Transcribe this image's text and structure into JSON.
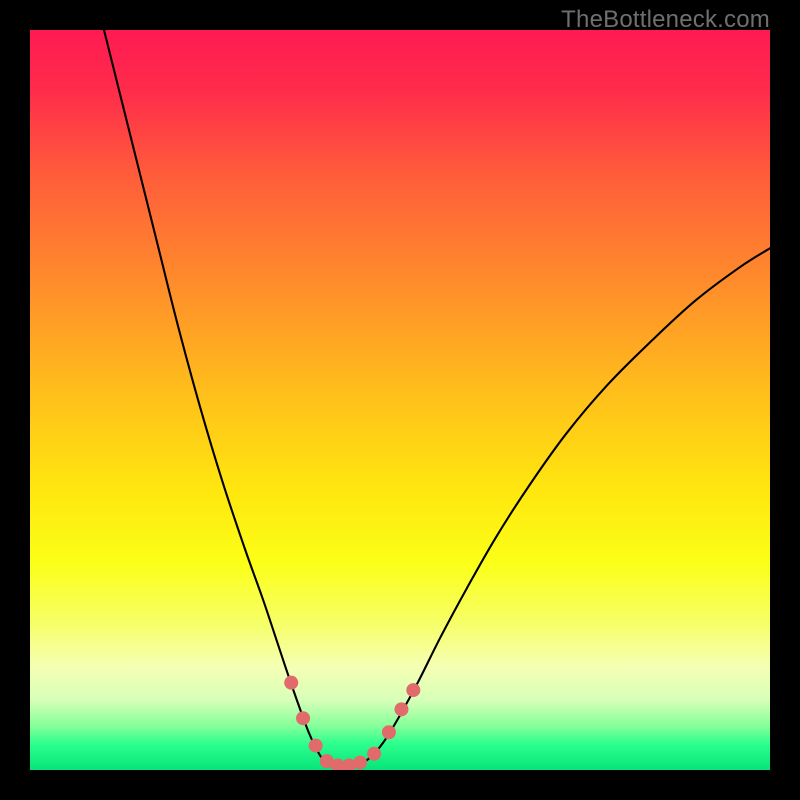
{
  "watermark": "TheBottleneck.com",
  "chart_data": {
    "type": "line",
    "title": "",
    "xlabel": "",
    "ylabel": "",
    "xlim": [
      0,
      100
    ],
    "ylim": [
      0,
      100
    ],
    "background_gradient": {
      "stops": [
        {
          "offset": 0.0,
          "color": "#ff1a52"
        },
        {
          "offset": 0.08,
          "color": "#ff2b4b"
        },
        {
          "offset": 0.2,
          "color": "#ff5e3a"
        },
        {
          "offset": 0.35,
          "color": "#ff8f2a"
        },
        {
          "offset": 0.5,
          "color": "#ffc21a"
        },
        {
          "offset": 0.62,
          "color": "#ffe60f"
        },
        {
          "offset": 0.72,
          "color": "#fbff17"
        },
        {
          "offset": 0.8,
          "color": "#f6ff66"
        },
        {
          "offset": 0.86,
          "color": "#f5ffb3"
        },
        {
          "offset": 0.905,
          "color": "#d8ffb8"
        },
        {
          "offset": 0.94,
          "color": "#86ff9a"
        },
        {
          "offset": 0.965,
          "color": "#2bff8d"
        },
        {
          "offset": 1.0,
          "color": "#08e47a"
        }
      ]
    },
    "series": [
      {
        "name": "curve-left",
        "color": "#000000",
        "width": 2.1,
        "points": [
          {
            "x": 10.0,
            "y": 100.0
          },
          {
            "x": 12.0,
            "y": 92.0
          },
          {
            "x": 14.5,
            "y": 82.0
          },
          {
            "x": 17.0,
            "y": 72.0
          },
          {
            "x": 20.0,
            "y": 60.0
          },
          {
            "x": 23.0,
            "y": 49.0
          },
          {
            "x": 26.0,
            "y": 39.0
          },
          {
            "x": 29.0,
            "y": 30.0
          },
          {
            "x": 31.5,
            "y": 23.0
          },
          {
            "x": 33.5,
            "y": 17.0
          },
          {
            "x": 35.0,
            "y": 12.5
          },
          {
            "x": 36.4,
            "y": 8.5
          },
          {
            "x": 37.7,
            "y": 5.0
          },
          {
            "x": 39.0,
            "y": 2.3
          },
          {
            "x": 40.0,
            "y": 1.0
          },
          {
            "x": 41.0,
            "y": 0.55
          },
          {
            "x": 42.0,
            "y": 0.5
          }
        ]
      },
      {
        "name": "curve-right",
        "color": "#000000",
        "width": 2.1,
        "points": [
          {
            "x": 42.0,
            "y": 0.5
          },
          {
            "x": 43.5,
            "y": 0.55
          },
          {
            "x": 45.0,
            "y": 1.0
          },
          {
            "x": 46.5,
            "y": 2.2
          },
          {
            "x": 48.0,
            "y": 4.1
          },
          {
            "x": 50.0,
            "y": 7.4
          },
          {
            "x": 52.5,
            "y": 12.0
          },
          {
            "x": 55.5,
            "y": 18.0
          },
          {
            "x": 59.0,
            "y": 24.5
          },
          {
            "x": 63.0,
            "y": 31.5
          },
          {
            "x": 67.5,
            "y": 38.5
          },
          {
            "x": 72.5,
            "y": 45.5
          },
          {
            "x": 78.0,
            "y": 52.0
          },
          {
            "x": 84.0,
            "y": 58.0
          },
          {
            "x": 90.0,
            "y": 63.5
          },
          {
            "x": 96.0,
            "y": 68.0
          },
          {
            "x": 100.0,
            "y": 70.5
          }
        ]
      }
    ],
    "markers": {
      "name": "bottleneck-markers",
      "color": "#e16a6a",
      "radius": 7,
      "points": [
        {
          "x": 35.3,
          "y": 11.8
        },
        {
          "x": 36.9,
          "y": 7.0
        },
        {
          "x": 38.6,
          "y": 3.3
        },
        {
          "x": 40.1,
          "y": 1.2
        },
        {
          "x": 41.6,
          "y": 0.6
        },
        {
          "x": 43.1,
          "y": 0.6
        },
        {
          "x": 44.6,
          "y": 1.0
        },
        {
          "x": 46.5,
          "y": 2.2
        },
        {
          "x": 48.5,
          "y": 5.1
        },
        {
          "x": 50.2,
          "y": 8.2
        },
        {
          "x": 51.8,
          "y": 10.8
        }
      ]
    }
  }
}
